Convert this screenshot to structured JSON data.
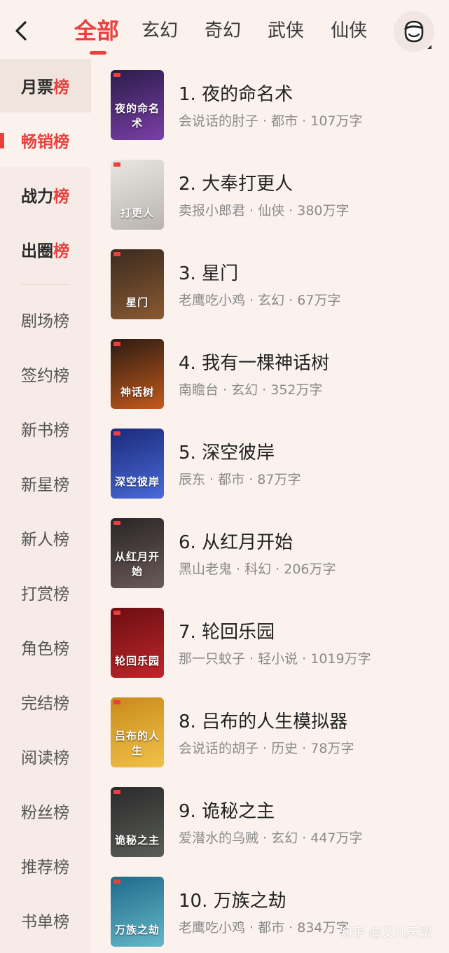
{
  "header": {
    "tabs": [
      {
        "label": "全部",
        "active": true
      },
      {
        "label": "玄幻",
        "active": false
      },
      {
        "label": "奇幻",
        "active": false
      },
      {
        "label": "武侠",
        "active": false
      },
      {
        "label": "仙侠",
        "active": false
      }
    ],
    "back_icon": "chevron-left-icon",
    "avatar_icon": "user-avatar-icon"
  },
  "sidebar": {
    "items": [
      {
        "pre": "月票",
        "hl": "榜"
      },
      {
        "pre": "畅销榜",
        "hl": ""
      },
      {
        "pre": "战力",
        "hl": "榜"
      },
      {
        "pre": "出圈",
        "hl": "榜"
      },
      {
        "pre": "剧场榜",
        "hl": ""
      },
      {
        "pre": "签约榜",
        "hl": ""
      },
      {
        "pre": "新书榜",
        "hl": ""
      },
      {
        "pre": "新星榜",
        "hl": ""
      },
      {
        "pre": "新人榜",
        "hl": ""
      },
      {
        "pre": "打赏榜",
        "hl": ""
      },
      {
        "pre": "角色榜",
        "hl": ""
      },
      {
        "pre": "完结榜",
        "hl": ""
      },
      {
        "pre": "阅读榜",
        "hl": ""
      },
      {
        "pre": "粉丝榜",
        "hl": ""
      },
      {
        "pre": "推荐榜",
        "hl": ""
      },
      {
        "pre": "书单榜",
        "hl": ""
      }
    ],
    "active_index": 1
  },
  "books": [
    {
      "title": "1. 夜的命名术",
      "meta": "会说话的肘子 · 都市 · 107万字",
      "cover_text": "夜的命名术",
      "cover_colors": [
        "#2a1d4a",
        "#7b3ea8"
      ]
    },
    {
      "title": "2. 大奉打更人",
      "meta": "卖报小郎君 · 仙侠 · 380万字",
      "cover_text": "打更人",
      "cover_colors": [
        "#e9e6e2",
        "#b9b4ad"
      ]
    },
    {
      "title": "3. 星门",
      "meta": "老鹰吃小鸡 · 玄幻 · 67万字",
      "cover_text": "星门",
      "cover_colors": [
        "#3a2a1e",
        "#8a5a32"
      ]
    },
    {
      "title": "4. 我有一棵神话树",
      "meta": "南瞻台 · 玄幻 · 352万字",
      "cover_text": "神话树",
      "cover_colors": [
        "#2b1b12",
        "#c45a1c"
      ]
    },
    {
      "title": "5. 深空彼岸",
      "meta": "辰东 · 都市 · 87万字",
      "cover_text": "深空彼岸",
      "cover_colors": [
        "#1a2a7a",
        "#4a6ad8"
      ]
    },
    {
      "title": "6. 从红月开始",
      "meta": "黑山老鬼 · 科幻 · 206万字",
      "cover_text": "从红月开始",
      "cover_colors": [
        "#2a2426",
        "#6a5b58"
      ]
    },
    {
      "title": "7. 轮回乐园",
      "meta": "那一只蚊子 · 轻小说 · 1019万字",
      "cover_text": "轮回乐园",
      "cover_colors": [
        "#6a0e12",
        "#c0262a"
      ]
    },
    {
      "title": "8. 吕布的人生模拟器",
      "meta": "会说话的胡子 · 历史 · 78万字",
      "cover_text": "吕布的人生",
      "cover_colors": [
        "#c98a1a",
        "#f0c24a"
      ]
    },
    {
      "title": "9. 诡秘之主",
      "meta": "爱潜水的乌贼 · 玄幻 · 447万字",
      "cover_text": "诡秘之主",
      "cover_colors": [
        "#2a2a2a",
        "#5a5d58"
      ]
    },
    {
      "title": "10. 万族之劫",
      "meta": "老鹰吃小鸡 · 都市 · 834万字",
      "cover_text": "万族之劫",
      "cover_colors": [
        "#1e6a8a",
        "#66b8c8"
      ]
    }
  ],
  "watermark": "知乎 @艾儿天空"
}
